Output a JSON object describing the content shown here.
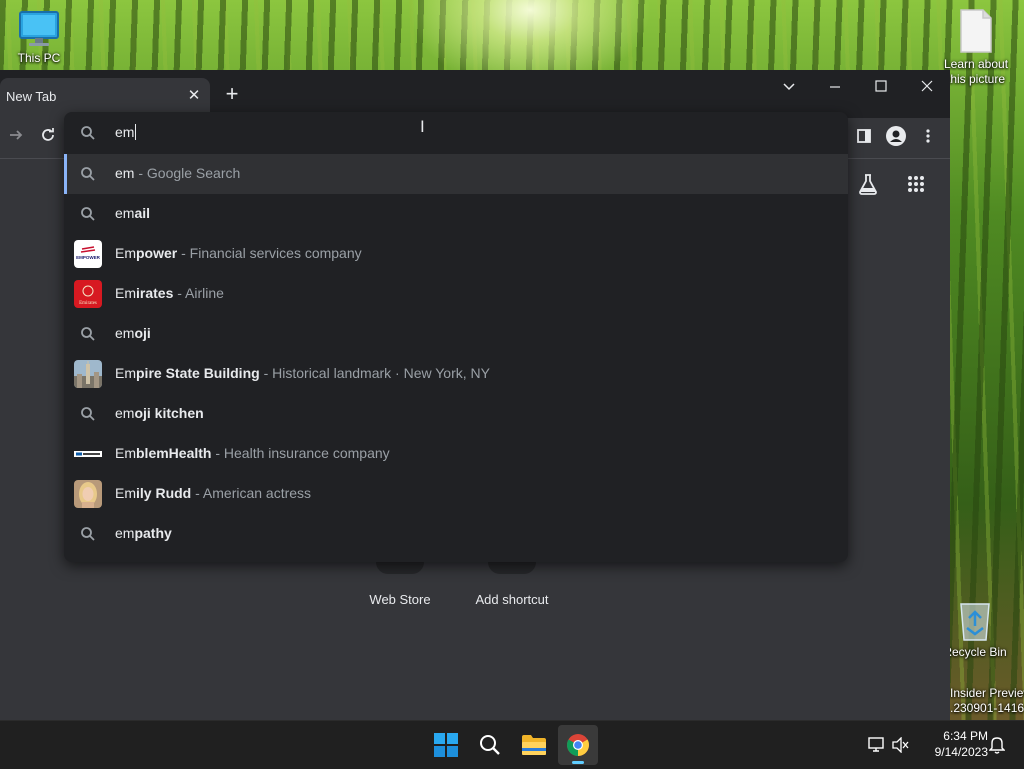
{
  "desktop": {
    "icons": [
      {
        "label": "This PC"
      },
      {
        "label_line1": "Learn about",
        "label_line2": "this picture"
      },
      {
        "label": "Recycle Bin"
      }
    ],
    "watermark_line1": "Insider Preview",
    "watermark_line2": ".230901-1416"
  },
  "browser": {
    "tab_title": "New Tab",
    "omnibox_value": "em",
    "suggestions": [
      {
        "match": "em",
        "rest": "",
        "desc": " - Google Search",
        "icon": "search-icon"
      },
      {
        "match": "em",
        "rest": "ail",
        "desc": "",
        "icon": "search-icon"
      },
      {
        "match": "Em",
        "rest": "power",
        "desc": " - Financial services company",
        "icon": "empower-logo"
      },
      {
        "match": "Em",
        "rest": "irates",
        "desc": " - Airline",
        "icon": "emirates-logo"
      },
      {
        "match": "em",
        "rest": "oji",
        "desc": "",
        "icon": "search-icon"
      },
      {
        "match": "Em",
        "rest": "pire State Building",
        "desc": " - Historical landmark · New York, NY",
        "icon": "empire-state-thumbnail"
      },
      {
        "match": "em",
        "rest": "oji kitchen",
        "desc": "",
        "icon": "search-icon"
      },
      {
        "match": "Em",
        "rest": "blemHealth",
        "desc": " - Health insurance company",
        "icon": "emblemhealth-logo"
      },
      {
        "match": "Em",
        "rest": "ily Rudd",
        "desc": " - American actress",
        "icon": "emily-rudd-thumbnail"
      },
      {
        "match": "em",
        "rest": "pathy",
        "desc": "",
        "icon": "search-icon"
      }
    ],
    "logo_texts": {
      "empower": "EMPOWER",
      "emirates": "Emirates"
    },
    "shortcuts": [
      {
        "label": "Web Store"
      },
      {
        "label": "Add shortcut"
      }
    ]
  },
  "taskbar": {
    "time": "6:34 PM",
    "date": "9/14/2023"
  },
  "colors": {
    "accent": "#8ab4f8",
    "omnibox_bg": "#202124",
    "window_bg": "#35363a",
    "taskbar_bg": "#202020"
  }
}
